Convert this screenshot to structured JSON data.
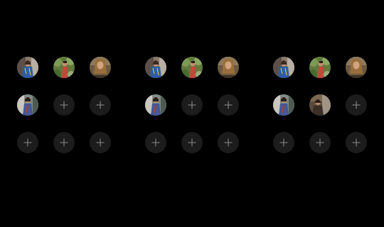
{
  "panels": [
    {
      "slots": [
        {
          "type": "photo",
          "variant": "person-blue-dress"
        },
        {
          "type": "photo",
          "variant": "person-green-garden"
        },
        {
          "type": "photo",
          "variant": "person-brown-hair"
        },
        {
          "type": "photo",
          "variant": "person-blue-dress-2"
        },
        {
          "type": "empty",
          "icon": "plus-icon"
        },
        {
          "type": "empty",
          "icon": "plus-icon"
        },
        {
          "type": "empty",
          "icon": "plus-icon"
        },
        {
          "type": "empty",
          "icon": "plus-icon"
        },
        {
          "type": "empty",
          "icon": "plus-icon"
        }
      ]
    },
    {
      "slots": [
        {
          "type": "photo",
          "variant": "person-blue-dress"
        },
        {
          "type": "photo",
          "variant": "person-green-garden"
        },
        {
          "type": "photo",
          "variant": "person-brown-hair"
        },
        {
          "type": "photo",
          "variant": "person-blue-dress-2"
        },
        {
          "type": "empty",
          "icon": "plus-icon"
        },
        {
          "type": "empty",
          "icon": "plus-icon"
        },
        {
          "type": "empty",
          "icon": "plus-icon"
        },
        {
          "type": "empty",
          "icon": "plus-icon"
        },
        {
          "type": "empty",
          "icon": "plus-icon"
        }
      ]
    },
    {
      "slots": [
        {
          "type": "photo",
          "variant": "person-blue-dress"
        },
        {
          "type": "photo",
          "variant": "person-green-garden"
        },
        {
          "type": "photo",
          "variant": "person-brown-hair"
        },
        {
          "type": "photo",
          "variant": "person-blue-dress-2"
        },
        {
          "type": "photo",
          "variant": "person-dark-room"
        },
        {
          "type": "empty",
          "icon": "plus-icon"
        },
        {
          "type": "empty",
          "icon": "plus-icon"
        },
        {
          "type": "empty",
          "icon": "plus-icon"
        },
        {
          "type": "empty",
          "icon": "plus-icon"
        }
      ]
    }
  ],
  "colors": {
    "background": "#000000",
    "empty_slot": "#1c1c1c",
    "plus": "#8e8e8e"
  }
}
